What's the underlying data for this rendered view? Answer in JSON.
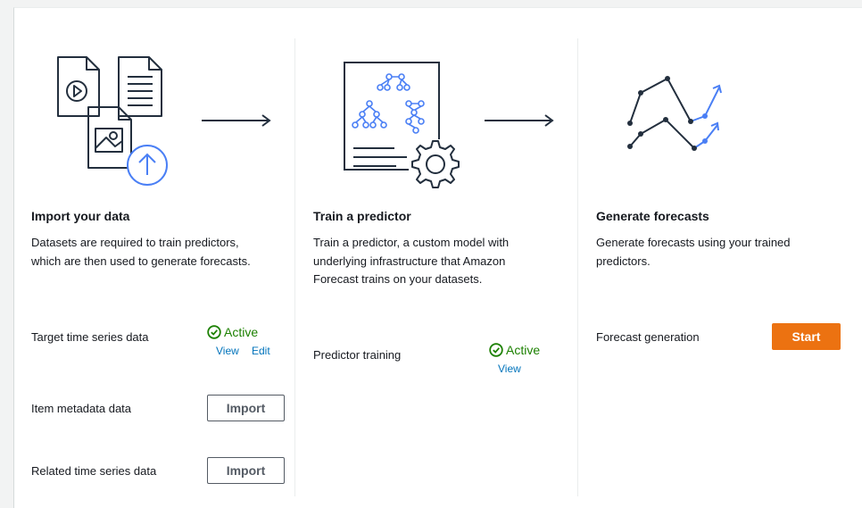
{
  "steps": [
    {
      "title": "Import your data",
      "description_lines": [
        "Datasets are required to train predictors,",
        "which are then used to generate forecasts."
      ],
      "rows": [
        {
          "label": "Target time series data",
          "status": "Active",
          "links": [
            "View",
            "Edit"
          ]
        },
        {
          "label": "Item metadata data",
          "button": "Import"
        },
        {
          "label": "Related time series data",
          "button": "Import"
        }
      ]
    },
    {
      "title": "Train a predictor",
      "description_lines": [
        "Train a predictor, a custom model with",
        "underlying infrastructure that Amazon",
        "Forecast trains on your datasets."
      ],
      "rows": [
        {
          "label": "Predictor training",
          "status": "Active",
          "links": [
            "View"
          ]
        }
      ]
    },
    {
      "title": "Generate forecasts",
      "description_lines": [
        "Generate forecasts using your trained",
        "predictors."
      ],
      "rows": [
        {
          "label": "Forecast generation",
          "button": "Start"
        }
      ]
    }
  ],
  "icons": {
    "step1": "import-data-illustration",
    "step2": "train-predictor-illustration",
    "step3": "generate-forecasts-illustration",
    "arrow": "arrow-right-icon",
    "status": "check-circle-icon"
  },
  "colors": {
    "accent_blue": "#4a7ff5",
    "status_green": "#1d8102",
    "link_blue": "#0073bb",
    "primary_orange": "#ec7211"
  }
}
